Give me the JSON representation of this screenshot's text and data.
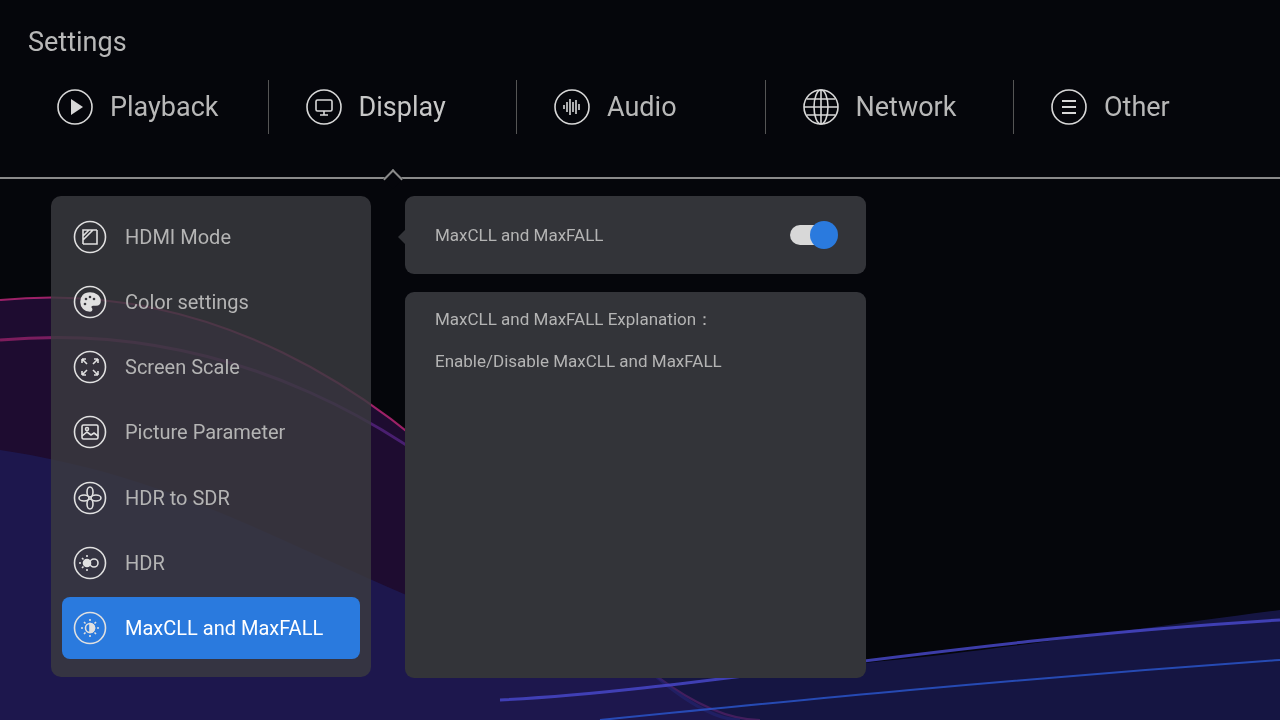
{
  "title": "Settings",
  "tabs": [
    {
      "label": "Playback",
      "selected": false
    },
    {
      "label": "Display",
      "selected": true
    },
    {
      "label": "Audio",
      "selected": false
    },
    {
      "label": "Network",
      "selected": false
    },
    {
      "label": "Other",
      "selected": false
    }
  ],
  "sidebar": {
    "items": [
      {
        "label": "HDMI Mode",
        "selected": false
      },
      {
        "label": "Color settings",
        "selected": false
      },
      {
        "label": "Screen Scale",
        "selected": false
      },
      {
        "label": "Picture Parameter",
        "selected": false
      },
      {
        "label": "HDR to SDR",
        "selected": false
      },
      {
        "label": "HDR",
        "selected": false
      },
      {
        "label": "MaxCLL and MaxFALL",
        "selected": true
      }
    ]
  },
  "setting": {
    "label": "MaxCLL and MaxFALL",
    "on": true
  },
  "explanation": {
    "title": "MaxCLL and MaxFALL Explanation：",
    "text": "Enable/Disable MaxCLL and MaxFALL"
  }
}
